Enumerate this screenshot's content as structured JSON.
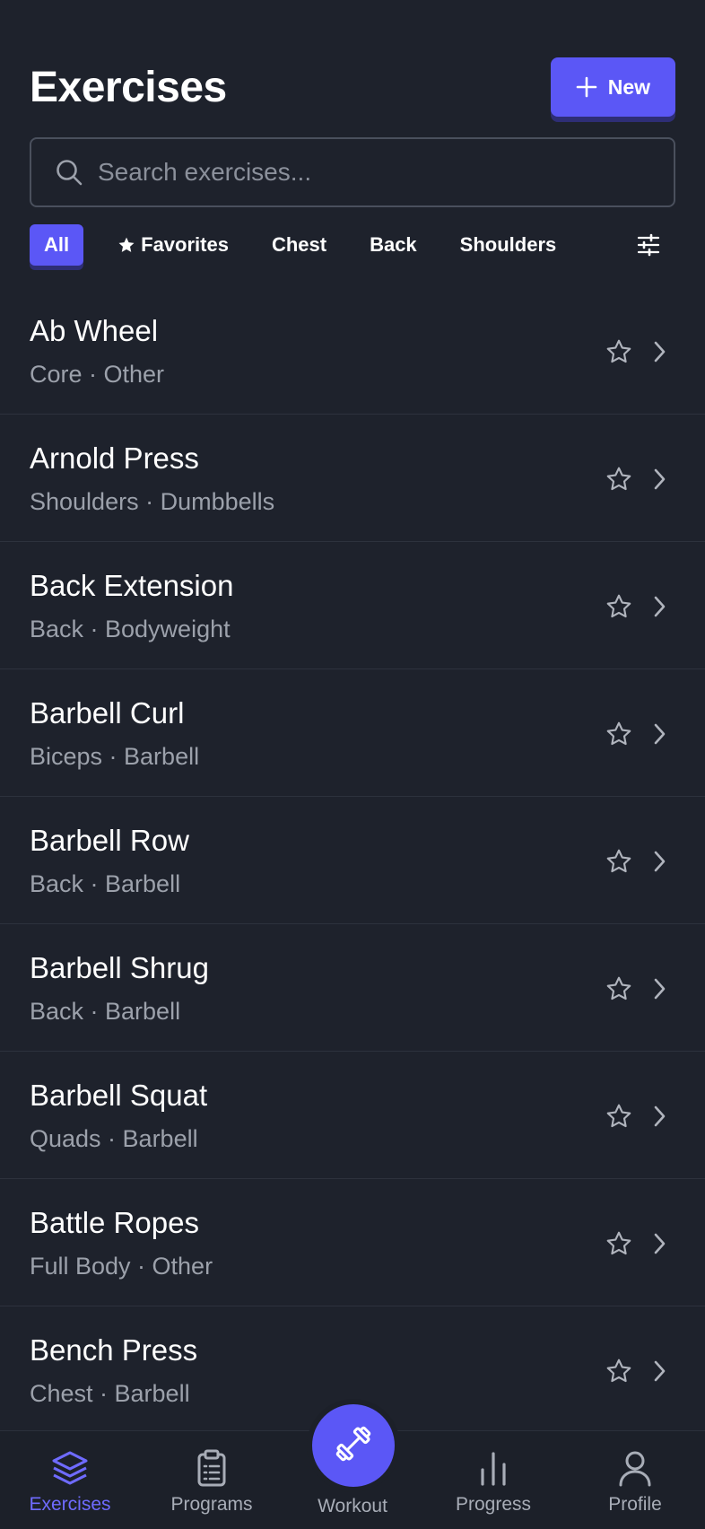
{
  "header": {
    "title": "Exercises",
    "new_label": "New"
  },
  "search": {
    "placeholder": "Search exercises..."
  },
  "filters": [
    {
      "label": "All",
      "active": true
    },
    {
      "label": "Favorites",
      "active": false
    },
    {
      "label": "Chest",
      "active": false
    },
    {
      "label": "Back",
      "active": false
    },
    {
      "label": "Shoulders",
      "active": false
    }
  ],
  "exercises": [
    {
      "name": "Ab Wheel",
      "meta": "Core · Other"
    },
    {
      "name": "Arnold Press",
      "meta": "Shoulders · Dumbbells"
    },
    {
      "name": "Back Extension",
      "meta": "Back · Bodyweight"
    },
    {
      "name": "Barbell Curl",
      "meta": "Biceps · Barbell"
    },
    {
      "name": "Barbell Row",
      "meta": "Back · Barbell"
    },
    {
      "name": "Barbell Shrug",
      "meta": "Back · Barbell"
    },
    {
      "name": "Barbell Squat",
      "meta": "Quads · Barbell"
    },
    {
      "name": "Battle Ropes",
      "meta": "Full Body · Other"
    },
    {
      "name": "Bench Press",
      "meta": "Chest · Barbell"
    }
  ],
  "tabbar": {
    "exercises": "Exercises",
    "programs": "Programs",
    "workout": "Workout",
    "progress": "Progress",
    "profile": "Profile"
  },
  "colors": {
    "accent": "#5b57f6",
    "background": "#1e222c",
    "muted_text": "#9ca1ab"
  },
  "icons": [
    "plus-icon",
    "search-icon",
    "star-icon",
    "sliders-icon",
    "chevron-right-icon",
    "layers-icon",
    "clipboard-icon",
    "dumbbell-icon",
    "bar-chart-icon",
    "user-icon"
  ]
}
